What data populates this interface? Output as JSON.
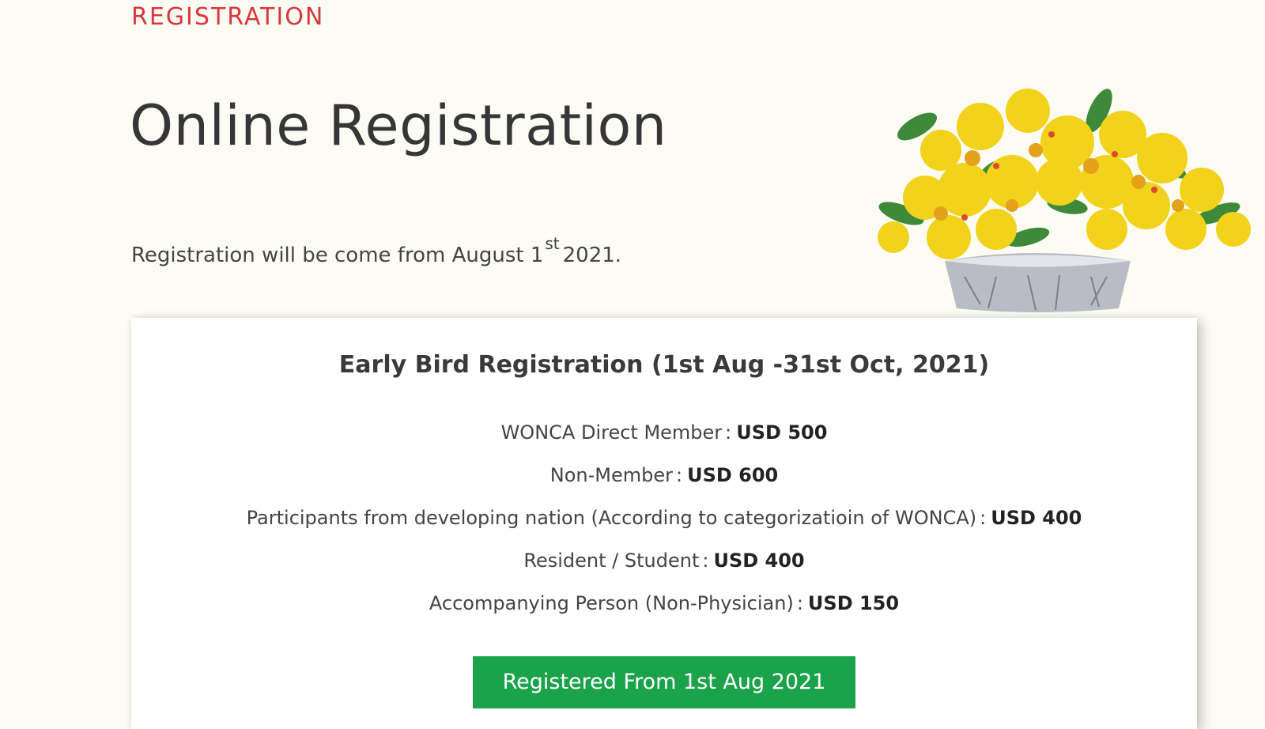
{
  "header": {
    "kicker": "REGISTRATION",
    "title": "Online Registration"
  },
  "intro": {
    "text_before": "Registration will be come from August 1",
    "superscript": "st",
    "text_after": "2021."
  },
  "card": {
    "title": "Early Bird Registration (1st Aug -31st Oct, 2021)",
    "fees": [
      {
        "label": "WONCA Direct Member",
        "price": "USD 500"
      },
      {
        "label": "Non-Member",
        "price": "USD 600"
      },
      {
        "label": "Participants from developing nation (According to categorizatioin of WONCA)",
        "price": "USD 400"
      },
      {
        "label": "Resident / Student",
        "price": "USD 400"
      },
      {
        "label": "Accompanying Person (Non-Physician)",
        "price": "USD 150"
      }
    ],
    "fee_separator": ":",
    "button_label": "Registered From 1st Aug 2021"
  },
  "colors": {
    "background": "#fcfcf4",
    "kicker": "#d8373b",
    "button": "#1aa34a"
  },
  "decorations": {
    "flower_image": "yellow-orchid-bouquet-in-silver-bowl"
  }
}
